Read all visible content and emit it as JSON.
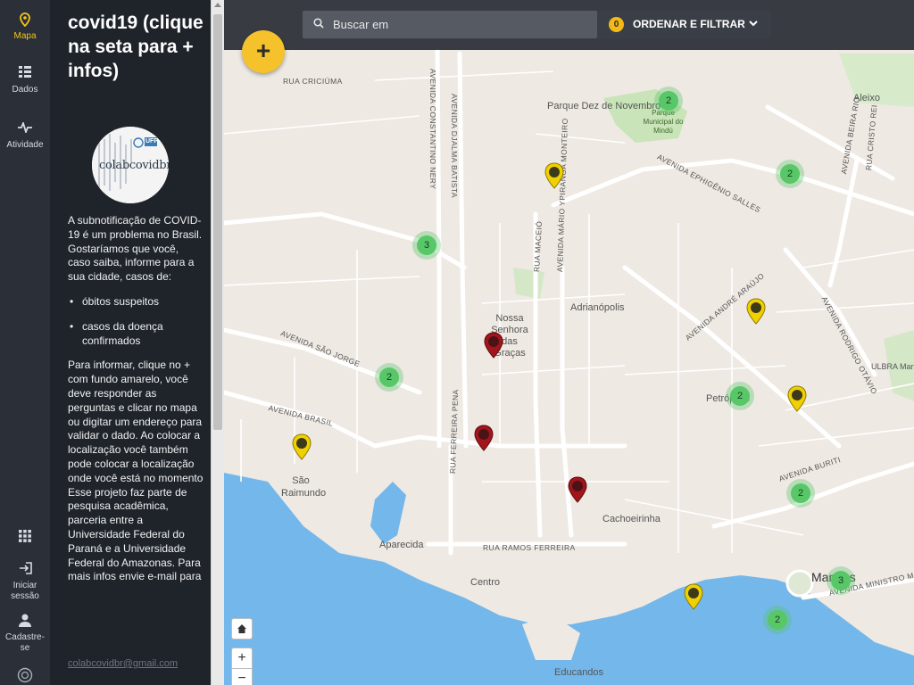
{
  "nav": {
    "items": [
      {
        "label": "Mapa",
        "icon": "location-pin-icon"
      },
      {
        "label": "Dados",
        "icon": "list-icon"
      },
      {
        "label": "Atividade",
        "icon": "pulse-icon"
      }
    ],
    "bottom": [
      {
        "label": "",
        "icon": "apps-grid-icon"
      },
      {
        "label": "Iniciar sessão",
        "icon": "login-icon"
      },
      {
        "label": "Cadastre-se",
        "icon": "user-icon"
      }
    ]
  },
  "panel": {
    "title": "covid19 (clique na seta para + infos)",
    "logo": {
      "text": "colabcovidbr",
      "tag": "UFPR"
    },
    "intro": "A subnotificação de COVID-19 é um problema no Brasil. Gostaríamos que você, caso saiba, informe para a sua cidade, casos de:",
    "bullets": [
      "óbitos suspeitos",
      "casos da doença confirmados"
    ],
    "body": "Para informar, clique no + com fundo amarelo, você deve responder as perguntas e clicar no mapa ou digitar um endereço para validar o dado. Ao colocar a localização você também pode colocar a localização onde você está no momento",
    "body2": "Esse projeto faz parte de pesquisa acadêmica, parceria entre a Universidade Federal do Paraná e a Universidade Federal do Amazonas. Para mais infos envie e-mail para",
    "email": "colabcovidbr@gmail.com"
  },
  "search": {
    "placeholder": "Buscar em"
  },
  "filter": {
    "count": "0",
    "label": "ORDENAR E FILTRAR"
  },
  "map_controls": {
    "add": "+",
    "home": "⌂",
    "zoom_in": "+",
    "zoom_out": "−"
  },
  "map": {
    "places": [
      {
        "label": "Parque Dez de Novembro"
      },
      {
        "label": "Aleixo"
      },
      {
        "label": "Nossa Senhora das Graças"
      },
      {
        "label": "Adrianópolis"
      },
      {
        "label": "Petrópolis"
      },
      {
        "label": "São Raimundo"
      },
      {
        "label": "Cachoeirinha"
      },
      {
        "label": "Aparecida"
      },
      {
        "label": "Centro"
      },
      {
        "label": "Manaus"
      },
      {
        "label": "Educandos"
      },
      {
        "label": "Parque Municipal do Mindú"
      },
      {
        "label": "ULBRA Manaus"
      }
    ],
    "roads": [
      {
        "label": "RUA CRICIÚMA"
      },
      {
        "label": "AVENIDA CONSTANTINO NERY"
      },
      {
        "label": "AVENIDA DJALMA BATISTA"
      },
      {
        "label": "AVENIDA EPHIGÊNIO SALLES"
      },
      {
        "label": "AVENIDA BEIRA RIO"
      },
      {
        "label": "RUA CRISTO REI"
      },
      {
        "label": "AVENIDA ANDRÉ ARAÚJO"
      },
      {
        "label": "AVENIDA RODRIGO OTÁVIO"
      },
      {
        "label": "AVENIDA SÃO JORGE"
      },
      {
        "label": "AVENIDA BRASIL"
      },
      {
        "label": "RUA MACEIÓ"
      },
      {
        "label": "AVENIDA MÁRIO YPIRANGA MONTEIRO"
      },
      {
        "label": "RUA FERREIRA PENA"
      },
      {
        "label": "RUA RAMOS FERREIRA"
      },
      {
        "label": "AVENIDA BURITI"
      },
      {
        "label": "AVENIDA MINISTRO MÁRIO ANDREAZZA"
      }
    ],
    "clusters": [
      {
        "count": "2"
      },
      {
        "count": "2"
      },
      {
        "count": "3"
      },
      {
        "count": "2"
      },
      {
        "count": "2"
      },
      {
        "count": "2"
      },
      {
        "count": "3"
      },
      {
        "count": "2"
      }
    ],
    "markers": [
      {
        "type": "yellow"
      },
      {
        "type": "yellow"
      },
      {
        "type": "yellow"
      },
      {
        "type": "yellow"
      },
      {
        "type": "yellow"
      },
      {
        "type": "red"
      },
      {
        "type": "red"
      },
      {
        "type": "red"
      }
    ]
  },
  "colors": {
    "accent": "#f5c518",
    "cluster": "#57c767",
    "marker_yellow": "#f0d000",
    "marker_red": "#a3141b",
    "water": "#74b7ea"
  }
}
